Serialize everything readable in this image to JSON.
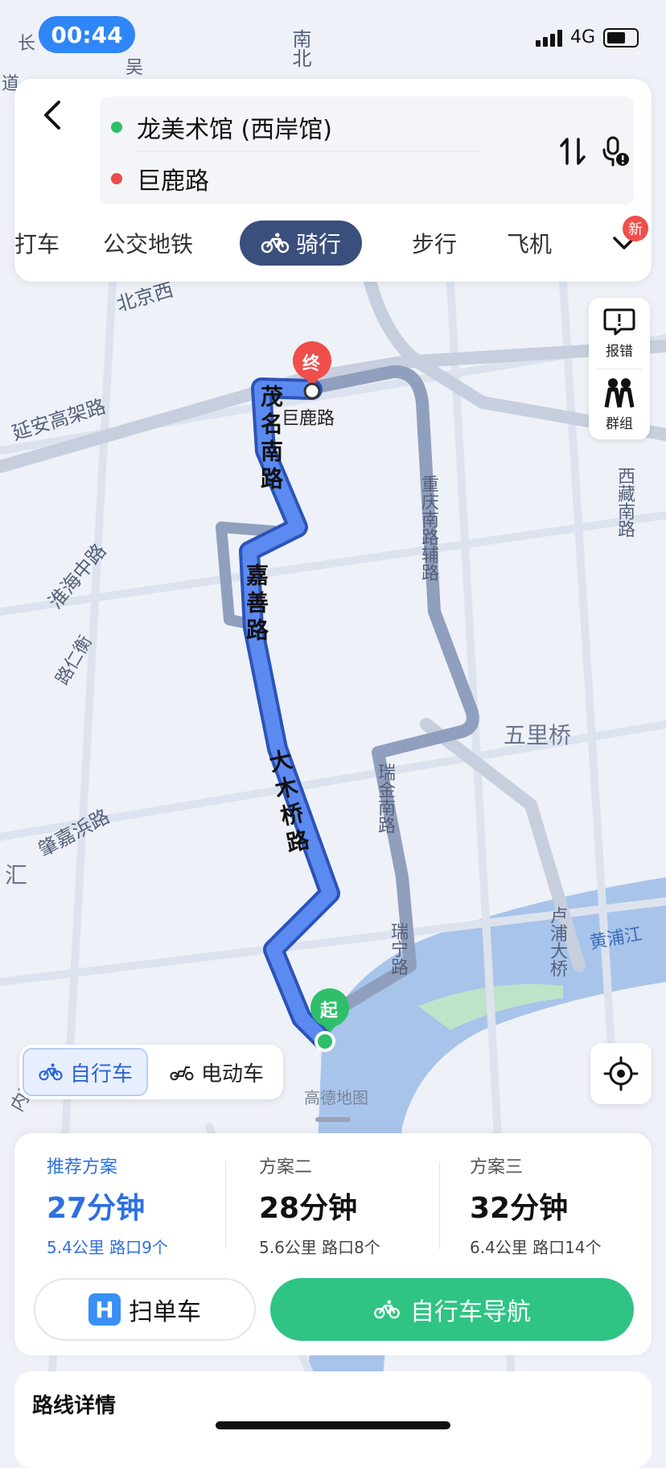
{
  "status_bar": {
    "time": "00:44",
    "network": "4G"
  },
  "route": {
    "origin": "龙美术馆 (西岸馆)",
    "destination": "巨鹿路"
  },
  "colors": {
    "origin_dot": "#2fbf6b",
    "destination_dot": "#e94a4a",
    "route_line": "#4d7fea",
    "accent": "#2d70e0",
    "nav_green": "#2fc484"
  },
  "tabs": [
    {
      "label": "打车"
    },
    {
      "label": "公交地铁"
    },
    {
      "label": "骑行",
      "active": true
    },
    {
      "label": "步行"
    },
    {
      "label": "飞机"
    }
  ],
  "more_badge": "新",
  "side_tools": {
    "report": "报错",
    "group": "群组"
  },
  "map": {
    "end_marker": "终",
    "start_marker": "起",
    "end_label": "巨鹿路",
    "watermark": "高德地图",
    "labels": {
      "yanan": "延安高架路",
      "beijing": "北京西",
      "nanbei": "南北",
      "maoming": "茂名南路",
      "jiashan": "嘉善路",
      "damuqiao": "大木桥路",
      "chongqing": "重庆南路辅路",
      "xizang": "西藏南路",
      "wuliqiao": "五里桥",
      "huaihai": "淮海中路",
      "zhaojiabang": "肇嘉浜路",
      "ruijin": "瑞金南路",
      "ruining": "瑞宁路",
      "lupu": "卢浦大桥",
      "huangpu": "黄浦江",
      "hui": "汇",
      "neihuan": "内环",
      "chang": "长",
      "dao": "道",
      "wu": "吴",
      "ruijinroad": "路仁衡"
    }
  },
  "modes": [
    {
      "label": "自行车",
      "active": true
    },
    {
      "label": "电动车"
    }
  ],
  "plans": [
    {
      "label": "推荐方案",
      "time": "27分钟",
      "detail": "5.4公里  路口9个",
      "active": true
    },
    {
      "label": "方案二",
      "time": "28分钟",
      "detail": "5.6公里  路口8个"
    },
    {
      "label": "方案三",
      "time": "32分钟",
      "detail": "6.4公里  路口14个"
    }
  ],
  "actions": {
    "scan": "扫单车",
    "navigate": "自行车导航"
  },
  "details_title": "路线详情"
}
